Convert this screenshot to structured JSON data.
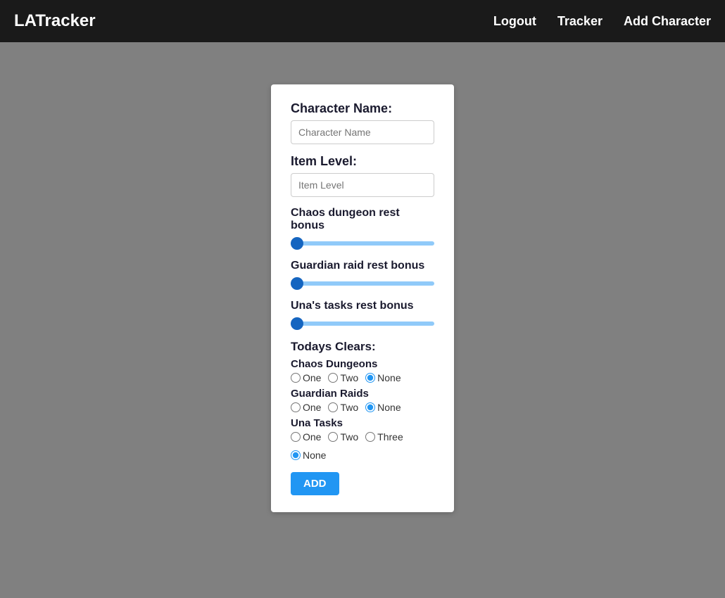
{
  "navbar": {
    "brand": "LATracker",
    "links": [
      {
        "label": "Logout",
        "name": "logout-link"
      },
      {
        "label": "Tracker",
        "name": "tracker-link"
      },
      {
        "label": "Add Character",
        "name": "add-character-link"
      }
    ]
  },
  "form": {
    "character_name_label": "Character Name:",
    "character_name_placeholder": "Character Name",
    "item_level_label": "Item Level:",
    "item_level_placeholder": "Item Level",
    "chaos_dungeon_label": "Chaos dungeon rest bonus",
    "chaos_dungeon_value": "0",
    "guardian_raid_label": "Guardian raid rest bonus",
    "guardian_raid_value": "0",
    "unas_tasks_label": "Una's tasks rest bonus",
    "unas_tasks_value": "0",
    "todays_clears_label": "Todays Clears:",
    "chaos_dungeons_group": {
      "label": "Chaos Dungeons",
      "options": [
        "One",
        "Two",
        "None"
      ],
      "selected": "None"
    },
    "guardian_raids_group": {
      "label": "Guardian Raids",
      "options": [
        "One",
        "Two",
        "None"
      ],
      "selected": "None"
    },
    "una_tasks_group": {
      "label": "Una Tasks",
      "options": [
        "One",
        "Two",
        "Three",
        "None"
      ],
      "selected": "None"
    },
    "add_button_label": "ADD"
  }
}
